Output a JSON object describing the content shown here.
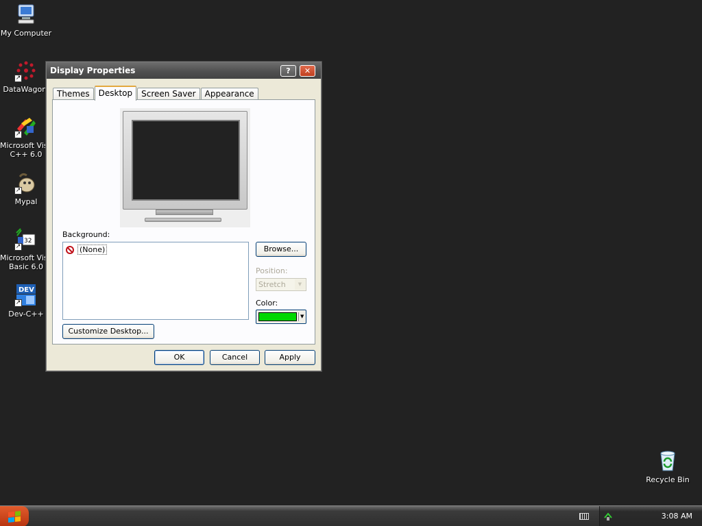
{
  "desktop": {
    "icons": [
      {
        "label": "My Computer",
        "icon": "computer-icon"
      },
      {
        "label": "DataWagon.",
        "icon": "datawagon-icon"
      },
      {
        "label": "Microsoft Visu",
        "label2": "C++ 6.0",
        "icon": "visual-cpp-icon"
      },
      {
        "label": "Mypal",
        "icon": "mypal-icon"
      },
      {
        "label": "Microsoft Visu",
        "label2": "Basic 6.0",
        "icon": "visual-basic-icon"
      },
      {
        "label": "Dev-C++",
        "icon": "dev-cpp-icon"
      },
      {
        "label": "Recycle Bin",
        "icon": "recycle-bin-icon"
      }
    ],
    "background_color": "#222222"
  },
  "dialog": {
    "title": "Display Properties",
    "help_label": "?",
    "close_label": "✕",
    "tabs": [
      {
        "label": "Themes",
        "active": false
      },
      {
        "label": "Desktop",
        "active": true
      },
      {
        "label": "Screen Saver",
        "active": false
      },
      {
        "label": "Appearance",
        "active": false
      }
    ],
    "background_label": "Background:",
    "background_items": [
      {
        "label": "(None)",
        "selected": true
      }
    ],
    "browse_label": "Browse...",
    "position_label": "Position:",
    "position_value": "Stretch",
    "color_label": "Color:",
    "color_value": "#00d800",
    "customize_label": "Customize Desktop...",
    "ok_label": "OK",
    "cancel_label": "Cancel",
    "apply_label": "Apply"
  },
  "taskbar": {
    "clock": "3:08 AM"
  }
}
